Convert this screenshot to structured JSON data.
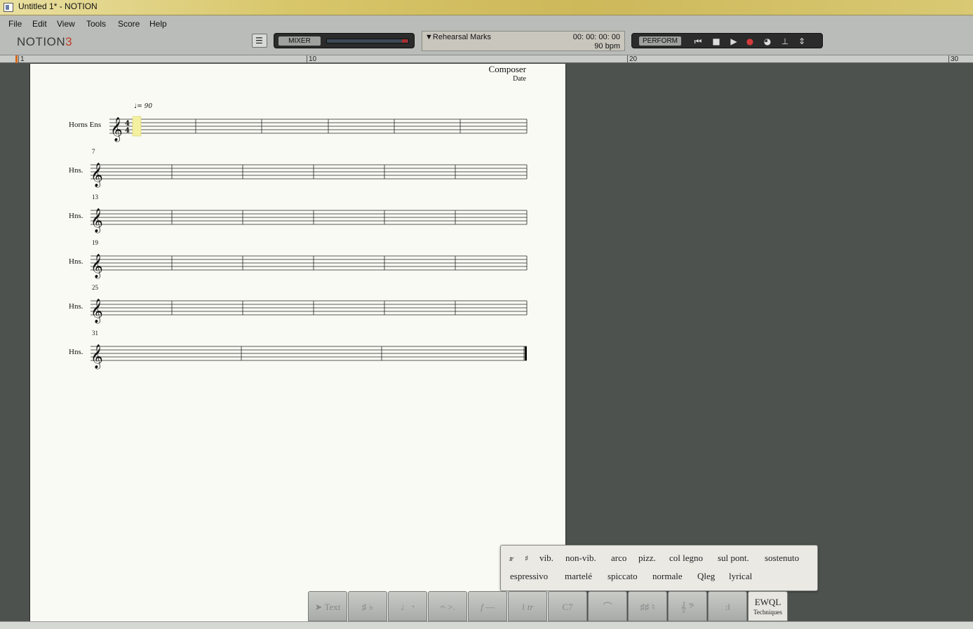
{
  "window": {
    "title": "Untitled 1* - NOTION"
  },
  "menu": [
    {
      "label": "File"
    },
    {
      "label": "Edit"
    },
    {
      "label": "View"
    },
    {
      "label": "Tools"
    },
    {
      "label": "Score"
    },
    {
      "label": "Help"
    }
  ],
  "logo": {
    "text": "NOTION",
    "version": "3"
  },
  "toolbar": {
    "mixer_label": "MIXER",
    "rehearsal_label": "▼Rehearsal Marks",
    "time": "00: 00: 00: 00",
    "bpm": "90 bpm",
    "perform_label": "PERFORM"
  },
  "ruler": {
    "marks": [
      "1",
      "10",
      "20",
      "30"
    ]
  },
  "score": {
    "composer": "Composer",
    "date": "Date",
    "tempo": "♩= 90",
    "first_label": "Horns Ens",
    "short_label": "Hns.",
    "measure_numbers": [
      "7",
      "13",
      "19",
      "25",
      "31"
    ]
  },
  "techniques": {
    "row1": [
      "vib.",
      "non-vib.",
      "arco",
      "pizz.",
      "col legno",
      "sul pont.",
      "sostenuto"
    ],
    "row2": [
      "espressivo",
      "martelé",
      "spiccato",
      "normale",
      "Qleg",
      "lyrical"
    ]
  },
  "palette_tabs": {
    "text": "Text",
    "chord": "C7",
    "ewql": "EWQL",
    "ewql_sub": "Techniques"
  },
  "colors": {
    "titlebar": "#d8c66a",
    "page": "#fafaf4",
    "workspace": "#4d524f",
    "record": "#d43b3b"
  }
}
